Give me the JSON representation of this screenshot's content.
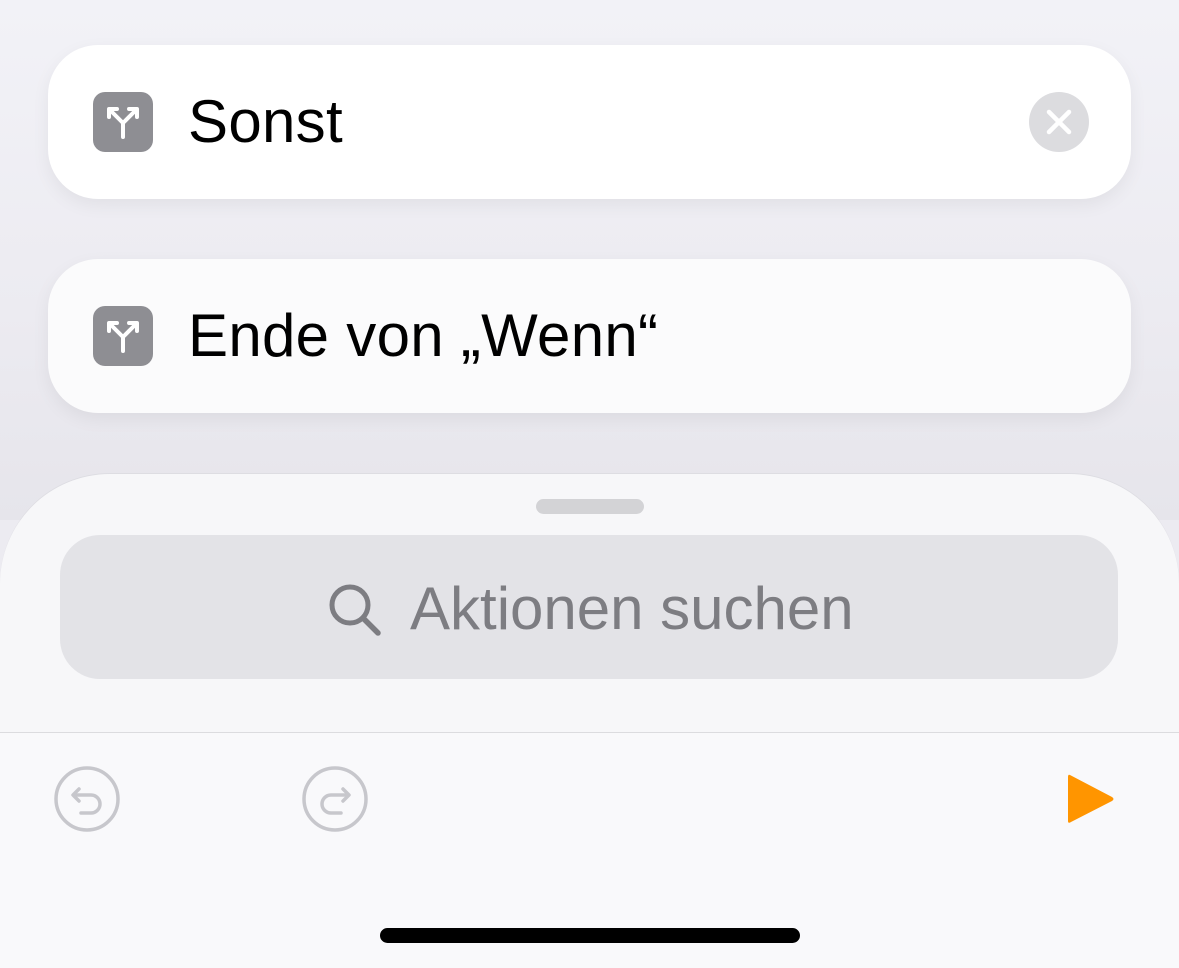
{
  "actions": [
    {
      "label": "Sonst",
      "icon": "branch-icon",
      "removable": true
    },
    {
      "label": "Ende von „Wenn“",
      "icon": "branch-icon",
      "removable": false
    }
  ],
  "search": {
    "placeholder": "Aktionen suchen"
  },
  "toolbar": {
    "undo_icon": "undo-icon",
    "redo_icon": "redo-icon",
    "play_icon": "play-icon"
  },
  "colors": {
    "action_icon_bg": "#8e8e93",
    "play_accent": "#ff9500",
    "disabled_icon": "#c7c7cc"
  }
}
